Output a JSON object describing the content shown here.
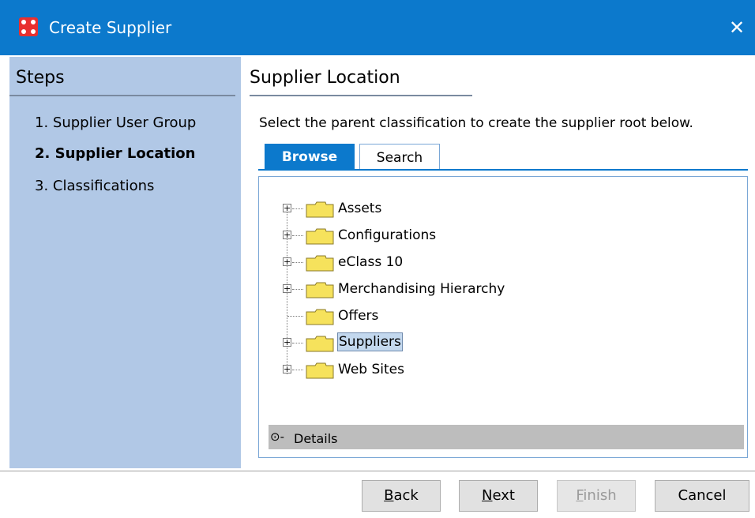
{
  "window": {
    "title": "Create Supplier",
    "close_symbol": "✕"
  },
  "steps": {
    "title": "Steps",
    "items": [
      {
        "label": "1. Supplier User Group",
        "current": false
      },
      {
        "label": "2. Supplier Location",
        "current": true
      },
      {
        "label": "3. Classifications",
        "current": false
      }
    ]
  },
  "main": {
    "title": "Supplier Location",
    "instruction": "Select the parent classification to create the supplier root below.",
    "tabs": [
      {
        "label": "Browse",
        "active": true
      },
      {
        "label": "Search",
        "active": false
      }
    ],
    "tree": [
      {
        "label": "Assets",
        "expandable": true,
        "selected": false
      },
      {
        "label": "Configurations",
        "expandable": true,
        "selected": false
      },
      {
        "label": "eClass 10",
        "expandable": true,
        "selected": false
      },
      {
        "label": "Merchandising Hierarchy",
        "expandable": true,
        "selected": false
      },
      {
        "label": "Offers",
        "expandable": false,
        "selected": false
      },
      {
        "label": "Suppliers",
        "expandable": true,
        "selected": true
      },
      {
        "label": "Web Sites",
        "expandable": true,
        "selected": false
      }
    ],
    "details_label": "Details",
    "details_icon": "⊙-"
  },
  "buttons": {
    "back": {
      "accel": "B",
      "rest": "ack"
    },
    "next": {
      "accel": "N",
      "rest": "ext"
    },
    "finish": {
      "accel": "F",
      "rest": "inish",
      "enabled": false
    },
    "cancel": {
      "label": "Cancel"
    }
  },
  "colors": {
    "titlebar": "#0c79cc",
    "steps_panel": "#b1c8e6",
    "folder": "#f6e25c",
    "selection": "#c3d8ee"
  }
}
